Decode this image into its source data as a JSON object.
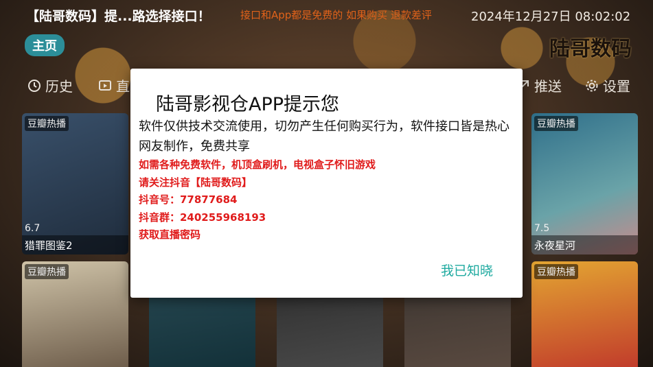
{
  "header": {
    "app_title": "【陆哥数码】提...路选择接口！",
    "marquee": "接口和App都是免费的 如果购买 退款差评",
    "datetime": "2024年12月27日 08:02:02",
    "home_label": "主页",
    "brand": "陆哥数码"
  },
  "nav": [
    {
      "label": "历史",
      "icon": "history-icon"
    },
    {
      "label": "直",
      "icon": "live-tv-icon"
    },
    {
      "label": "推送",
      "icon": "push-icon"
    },
    {
      "label": "设置",
      "icon": "gear-icon"
    }
  ],
  "cards": [
    {
      "tag": "豆瓣热播",
      "score": "6.7",
      "name": "猎罪图鉴2"
    },
    {
      "tag": "豆瓣热播",
      "score": "7.5",
      "name": "永夜星河"
    },
    {
      "tag": "豆瓣热播",
      "score": "",
      "name": ""
    },
    {
      "tag": "豆瓣热播",
      "score": "",
      "name": ""
    }
  ],
  "dialog": {
    "title": "陆哥影视仓APP提示您",
    "body": "软件仅供技术交流使用，切勿产生任何购买行为，软件接口皆是热心网友制作，免费共享",
    "lines": [
      "如需各种免费软件，机顶盒刷机，电视盒子怀旧游戏",
      "请关注抖音【陆哥数码】",
      "抖音号：77877684",
      "抖音群：240255968193",
      "获取直播密码"
    ],
    "ok_label": "我已知晓"
  }
}
